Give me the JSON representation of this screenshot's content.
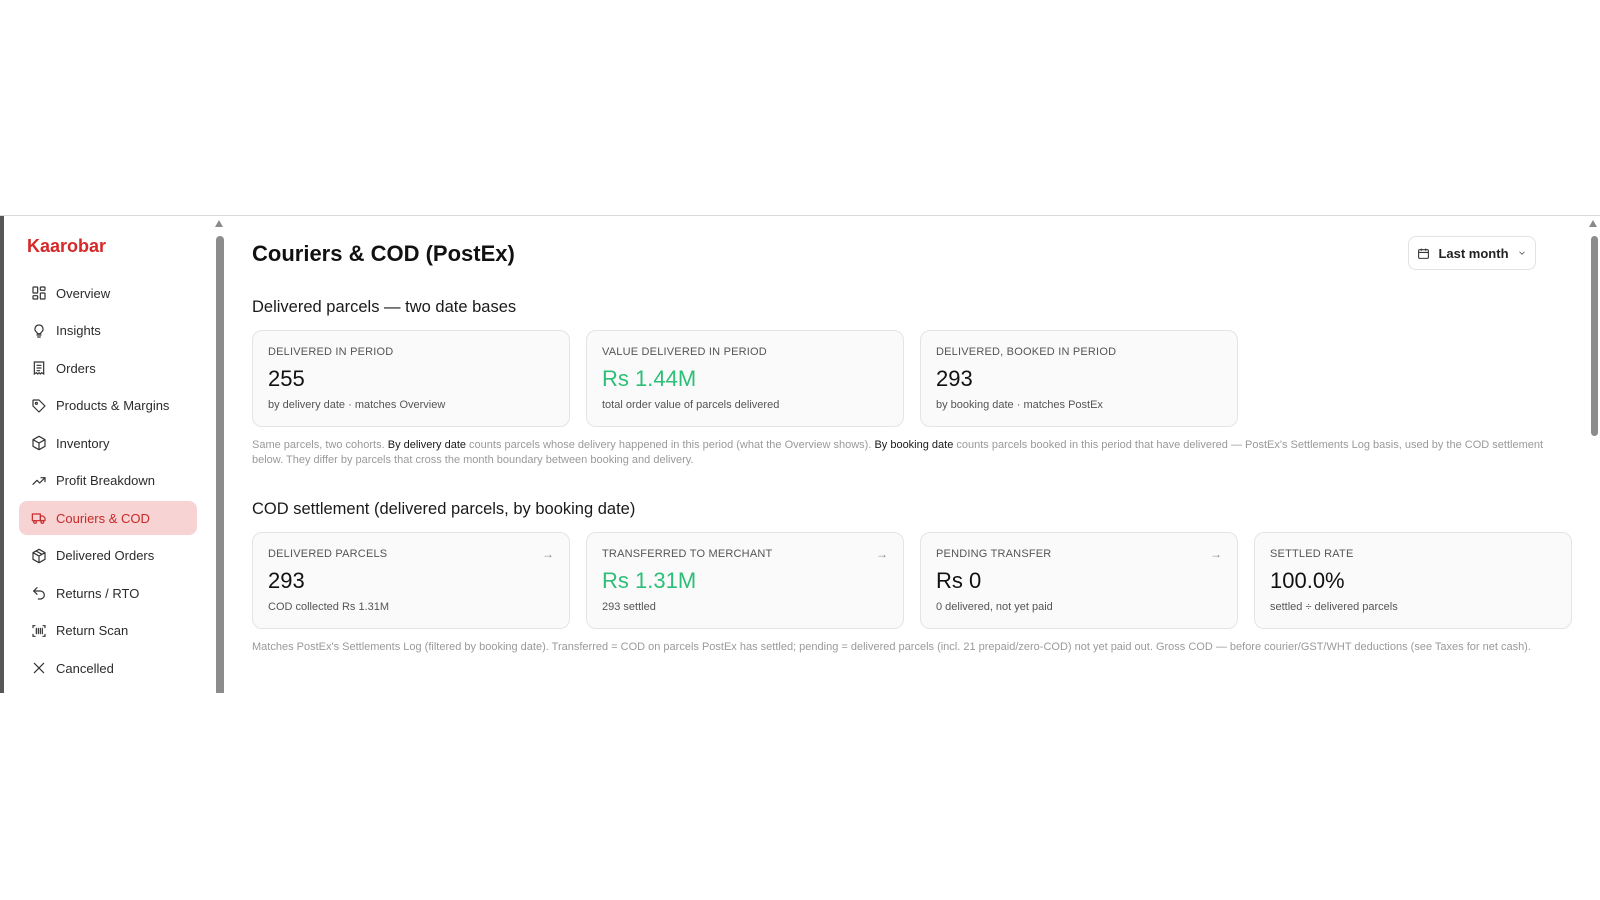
{
  "brand": "Kaarobar",
  "sidebar": {
    "items": [
      {
        "label": "Overview",
        "icon": "grid-icon",
        "active": false
      },
      {
        "label": "Insights",
        "icon": "lightbulb-icon",
        "active": false
      },
      {
        "label": "Orders",
        "icon": "receipt-icon",
        "active": false
      },
      {
        "label": "Products & Margins",
        "icon": "tag-icon",
        "active": false
      },
      {
        "label": "Inventory",
        "icon": "box-icon",
        "active": false
      },
      {
        "label": "Profit Breakdown",
        "icon": "trend-up-icon",
        "active": false
      },
      {
        "label": "Couriers & COD",
        "icon": "truck-icon",
        "active": true
      },
      {
        "label": "Delivered Orders",
        "icon": "package-icon",
        "active": false
      },
      {
        "label": "Returns / RTO",
        "icon": "undo-icon",
        "active": false
      },
      {
        "label": "Return Scan",
        "icon": "scan-icon",
        "active": false
      },
      {
        "label": "Cancelled",
        "icon": "x-icon",
        "active": false
      }
    ]
  },
  "header": {
    "title": "Couriers & COD (PostEx)",
    "date_range": "Last month"
  },
  "section1": {
    "title": "Delivered parcels — two date bases",
    "cards": [
      {
        "label": "DELIVERED IN PERIOD",
        "value": "255",
        "sub": "by delivery date · matches Overview"
      },
      {
        "label": "VALUE DELIVERED IN PERIOD",
        "value": "Rs 1.44M",
        "sub": "total order value of parcels delivered"
      },
      {
        "label": "DELIVERED, BOOKED IN PERIOD",
        "value": "293",
        "sub": "by booking date · matches PostEx"
      }
    ],
    "note": {
      "p1": "Same parcels, two cohorts. ",
      "b1": "By delivery date",
      "p2": " counts parcels whose delivery happened in this period (what the Overview shows). ",
      "b2": "By booking date",
      "p3": " counts parcels booked in this period that have delivered — PostEx's Settlements Log basis, used by the COD settlement below. They differ by parcels that cross the month boundary between booking and delivery."
    }
  },
  "section2": {
    "title": "COD settlement (delivered parcels, by booking date)",
    "cards": [
      {
        "label": "DELIVERED PARCELS",
        "value": "293",
        "sub": "COD collected Rs 1.31M",
        "arrow": "→"
      },
      {
        "label": "TRANSFERRED TO MERCHANT",
        "value": "Rs 1.31M",
        "sub": "293 settled",
        "arrow": "→"
      },
      {
        "label": "PENDING TRANSFER",
        "value": "Rs 0",
        "sub": "0 delivered, not yet paid",
        "arrow": "→"
      },
      {
        "label": "SETTLED RATE",
        "value": "100.0%",
        "sub": "settled ÷ delivered parcels"
      }
    ],
    "note": "Matches PostEx's Settlements Log (filtered by booking date). Transferred = COD on parcels PostEx has settled; pending = delivered parcels (incl. 21 prepaid/zero-COD) not yet paid out. Gross COD — before courier/GST/WHT deductions (see Taxes for net cash)."
  },
  "colors": {
    "brand": "#d62828",
    "active_bg": "#f8d3d3",
    "positive": "#2bbf77"
  }
}
